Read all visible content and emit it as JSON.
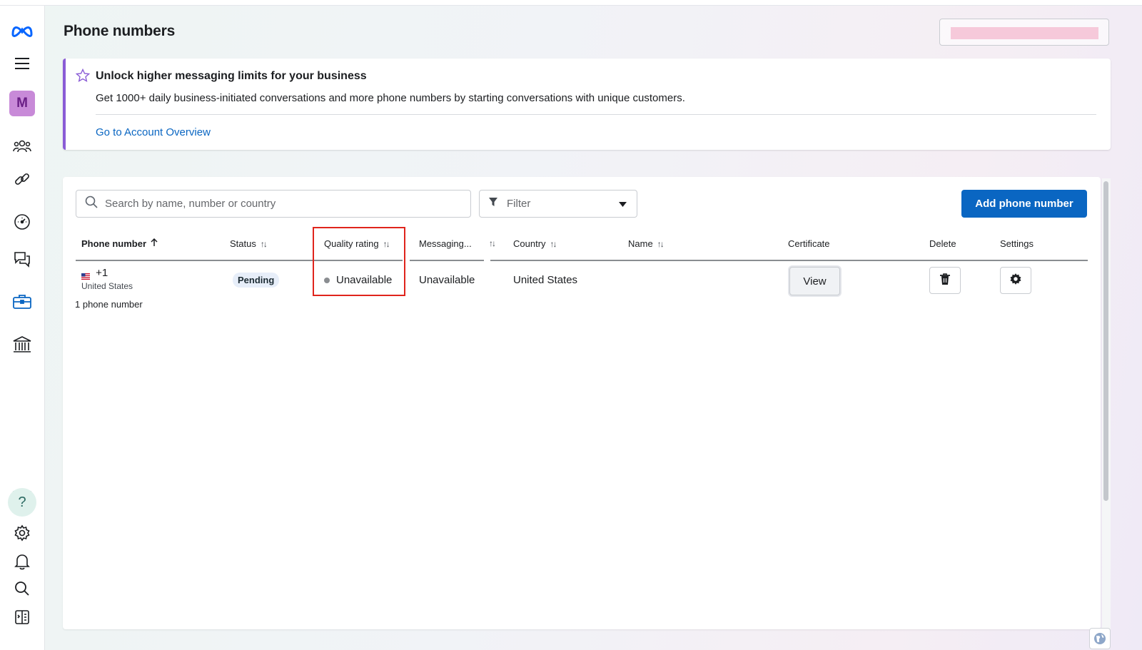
{
  "page": {
    "title": "Phone numbers"
  },
  "banner": {
    "title": "Unlock higher messaging limits for your business",
    "description": "Get 1000+ daily business-initiated conversations and more phone numbers by starting conversations with unique customers.",
    "link": "Go to Account Overview"
  },
  "sidebar": {
    "avatar_letter": "M",
    "help_glyph": "?",
    "icons": [
      "meta-logo-icon",
      "menu-icon",
      "people-icon",
      "link-icon",
      "dashboard-icon",
      "chat-icon",
      "briefcase-icon",
      "bank-icon",
      "help-icon",
      "gear-icon",
      "bell-icon",
      "search-icon",
      "panel-toggle-icon"
    ]
  },
  "toolbar": {
    "search_placeholder": "Search by name, number or country",
    "filter_label": "Filter",
    "add_button": "Add phone number"
  },
  "table": {
    "columns": {
      "phone": "Phone number",
      "status": "Status",
      "quality": "Quality rating",
      "messaging": "Messaging...",
      "country": "Country",
      "name": "Name",
      "certificate": "Certificate",
      "delete": "Delete",
      "settings": "Settings"
    },
    "rows": [
      {
        "phone": "+1",
        "phone_country": "United States",
        "status": "Pending",
        "quality": "Unavailable",
        "messaging": "Unavailable",
        "country": "United States",
        "name": "",
        "certificate_button": "View"
      }
    ],
    "count_text": "1 phone number"
  },
  "colors": {
    "primary": "#0a66c2",
    "banner_accent": "#8a5cd6",
    "highlight": "#e0241c",
    "avatar_bg": "#c88ad8"
  }
}
